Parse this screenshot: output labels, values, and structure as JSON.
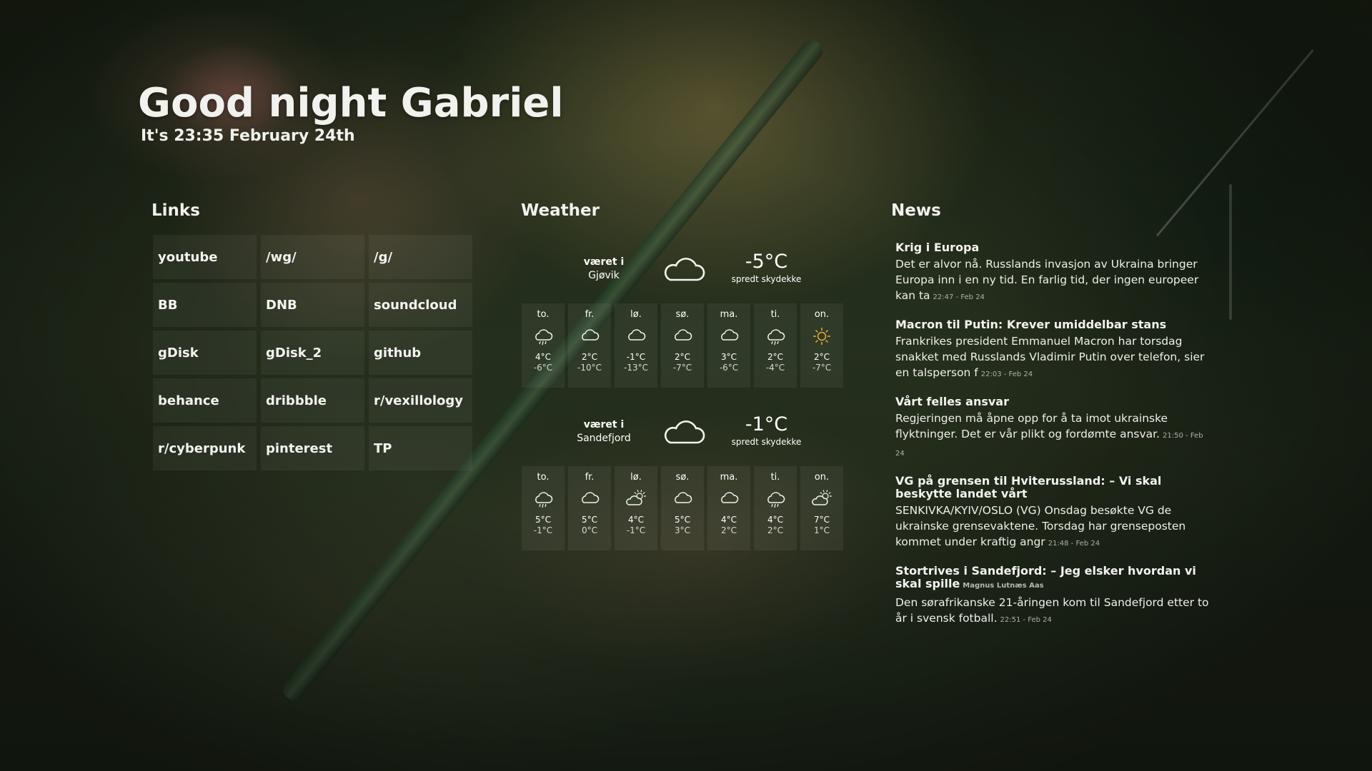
{
  "greeting": "Good night Gabriel",
  "subline": "It's 23:35 February 24th",
  "sections": {
    "links": "Links",
    "weather": "Weather",
    "news": "News"
  },
  "links": [
    "youtube",
    "/wg/",
    "/g/",
    "BB",
    "DNB",
    "soundcloud",
    "gDisk",
    "gDisk_2",
    "github",
    "behance",
    "dribbble",
    "r/vexillology",
    "r/cyberpunk",
    "pinterest",
    "TP"
  ],
  "weather": [
    {
      "loc_prefix": "været i",
      "location": "Gjøvik",
      "icon": "cloud-icon",
      "temp": "-5°C",
      "desc": "spredt skydekke",
      "days": [
        {
          "name": "to.",
          "icon": "rain-icon",
          "hi": "4°C",
          "lo": "-6°C"
        },
        {
          "name": "fr.",
          "icon": "cloud-icon",
          "hi": "2°C",
          "lo": "-10°C"
        },
        {
          "name": "lø.",
          "icon": "cloud-icon",
          "hi": "-1°C",
          "lo": "-13°C"
        },
        {
          "name": "sø.",
          "icon": "cloud-icon",
          "hi": "2°C",
          "lo": "-7°C"
        },
        {
          "name": "ma.",
          "icon": "cloud-icon",
          "hi": "3°C",
          "lo": "-6°C"
        },
        {
          "name": "ti.",
          "icon": "rain-icon",
          "hi": "2°C",
          "lo": "-4°C"
        },
        {
          "name": "on.",
          "icon": "sun-icon",
          "hi": "2°C",
          "lo": "-7°C"
        }
      ]
    },
    {
      "loc_prefix": "været i",
      "location": "Sandefjord",
      "icon": "cloud-icon",
      "temp": "-1°C",
      "desc": "spredt skydekke",
      "days": [
        {
          "name": "to.",
          "icon": "rain-icon",
          "hi": "5°C",
          "lo": "-1°C"
        },
        {
          "name": "fr.",
          "icon": "cloud-icon",
          "hi": "5°C",
          "lo": "0°C"
        },
        {
          "name": "lø.",
          "icon": "partly-cloudy-icon",
          "hi": "4°C",
          "lo": "-1°C"
        },
        {
          "name": "sø.",
          "icon": "cloud-icon",
          "hi": "5°C",
          "lo": "3°C"
        },
        {
          "name": "ma.",
          "icon": "cloud-icon",
          "hi": "4°C",
          "lo": "2°C"
        },
        {
          "name": "ti.",
          "icon": "rain-icon",
          "hi": "4°C",
          "lo": "2°C"
        },
        {
          "name": "on.",
          "icon": "partly-cloudy-icon",
          "hi": "7°C",
          "lo": "1°C"
        }
      ]
    }
  ],
  "news": [
    {
      "title": "Krig i Europa",
      "author": "",
      "body": "Det er alvor nå. Russlands invasjon av Ukraina bringer Europa inn i en ny tid. En farlig tid, der ingen europeer kan ta",
      "meta": "22:47 - Feb 24"
    },
    {
      "title": "Macron til Putin: Krever umiddelbar stans",
      "author": "",
      "body": "Frankrikes president Emmanuel Macron har torsdag snakket med Russlands Vladimir Putin over telefon, sier en talsperson f",
      "meta": "22:03 - Feb 24"
    },
    {
      "title": "Vårt felles ansvar",
      "author": "",
      "body": "Regjeringen må åpne opp for å ta imot ukrainske flyktninger. Det er vår plikt og fordømte ansvar.",
      "meta": "21:50 - Feb 24"
    },
    {
      "title": "VG på grensen til Hviterussland: – Vi skal beskytte landet vårt",
      "author": "",
      "body": "SENKIVKA/KYIV/OSLO (VG) Onsdag besøkte VG de ukrainske grensevaktene. Torsdag har grenseposten kommet under kraftig angr",
      "meta": "21:48 - Feb 24"
    },
    {
      "title": "Stortrives i Sandefjord: – Jeg elsker hvordan vi skal spille",
      "author": "Magnus Lutnæs Aas",
      "body": "Den sørafrikanske 21-åringen kom til Sandefjord etter to år i svensk fotball.",
      "meta": "22:51 - Feb 24"
    }
  ],
  "colors": {
    "sun": "#e9b030",
    "tile_bg": "rgba(255,255,255,0.05)"
  }
}
